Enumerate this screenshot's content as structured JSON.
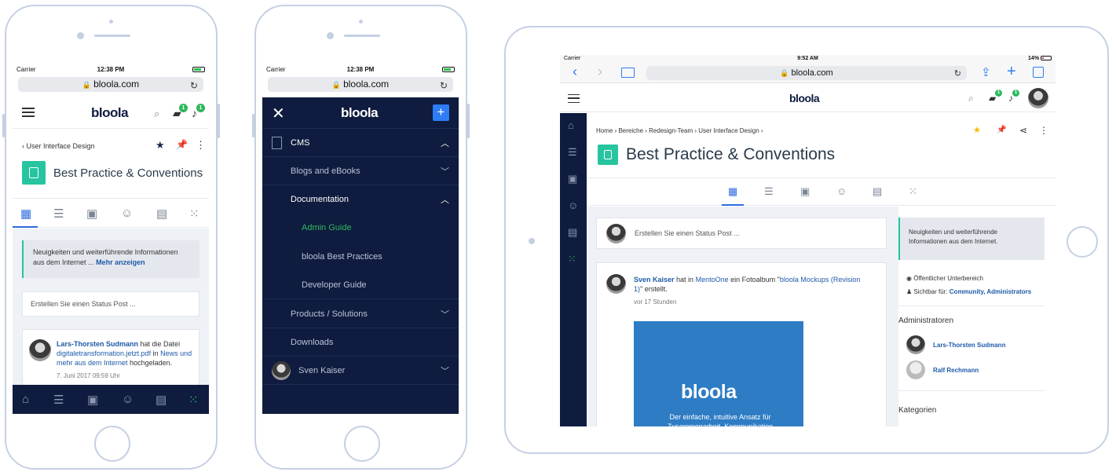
{
  "status": {
    "carrier": "Carrier",
    "time_phone": "12:38 PM",
    "time_tablet": "9:52 AM",
    "battery_tablet": "14%"
  },
  "browser": {
    "url": "bloola.com"
  },
  "brand": {
    "name": "bloola",
    "accent": "#0f1c3f",
    "green": "#2eb85c",
    "teal": "#27c4a0"
  },
  "phone1": {
    "badge_chat": "1",
    "badge_bell": "1",
    "back_label": "User Interface Design",
    "page_title": "Best Practice & Conventions",
    "info_text": "Neuigkeiten und weiterführende Informationen aus dem Internet ...",
    "more_link": "Mehr anzeigen",
    "status_placeholder": "Erstellen Sie einen Status Post ...",
    "activity": {
      "user": "Lars-Thorsten Sudmann",
      "verb1": "hat die Datei",
      "file": "digitaletransformation.jetzt.pdf",
      "verb2": "in",
      "target": "News und mehr aus dem Internet",
      "verb3": "hochgeladen.",
      "time": "7. Juni 2017 09:59 Uhr"
    }
  },
  "phone2": {
    "menu": [
      {
        "label": "CMS",
        "level": 0,
        "chevron": "up"
      },
      {
        "label": "Blogs and eBooks",
        "level": 1,
        "chevron": "down"
      },
      {
        "label": "Documentation",
        "level": 1,
        "chevron": "up"
      },
      {
        "label": "Admin Guide",
        "level": 2,
        "active": true
      },
      {
        "label": "bloola Best Practices",
        "level": 2
      },
      {
        "label": "Developer Guide",
        "level": 2
      },
      {
        "label": "Products / Solutions",
        "level": 1,
        "chevron": "down"
      },
      {
        "label": "Downloads",
        "level": 1
      }
    ],
    "user_name": "Sven Kaiser"
  },
  "tablet": {
    "badge_chat": "1",
    "badge_bell": "1",
    "breadcrumb": [
      "Home",
      "Bereiche",
      "Redesign-Team",
      "User Interface Design"
    ],
    "page_title": "Best Practice & Conventions",
    "status_placeholder": "Erstellen Sie einen Status Post ...",
    "post": {
      "user": "Sven Kaiser",
      "verb1": "hat in",
      "place": "MentoOne",
      "verb2": "ein Fotoalbum \"",
      "album": "bloola Mockups (Revision 1)",
      "verb3": "\" erstellt.",
      "time": "vor 17 Stunden",
      "image_brand": "bloola",
      "image_caption": "Der einfache, intuitive Ansatz für Zusammenarbeit, Kommunikation"
    },
    "sidebar": {
      "info_text": "Neuigkeiten und weiterführende Informationen aus dem Internet.",
      "visibility": "Öffentlicher Unterbereich",
      "visible_for_label": "Sichtbar für:",
      "visible_for_value": "Community, Administrators",
      "admins_title": "Administratoren",
      "admins": [
        "Lars-Thorsten Sudmann",
        "Ralf Rechmann"
      ],
      "categories_title": "Kategorien"
    }
  }
}
